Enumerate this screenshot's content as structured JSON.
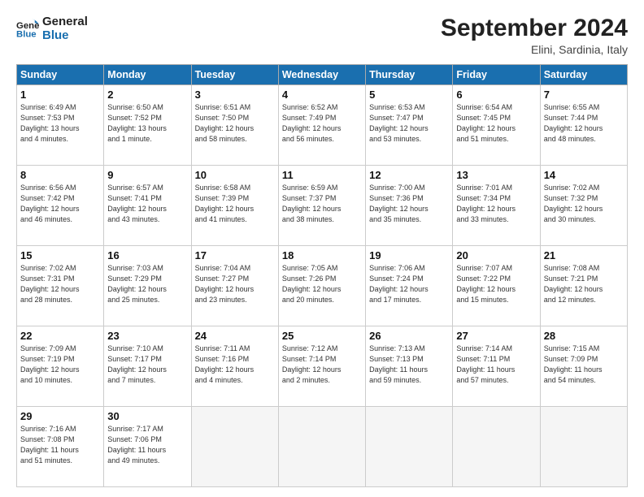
{
  "header": {
    "logo_line1": "General",
    "logo_line2": "Blue",
    "month_title": "September 2024",
    "location": "Elini, Sardinia, Italy"
  },
  "columns": [
    "Sunday",
    "Monday",
    "Tuesday",
    "Wednesday",
    "Thursday",
    "Friday",
    "Saturday"
  ],
  "weeks": [
    [
      {
        "day": "1",
        "info": "Sunrise: 6:49 AM\nSunset: 7:53 PM\nDaylight: 13 hours\nand 4 minutes."
      },
      {
        "day": "2",
        "info": "Sunrise: 6:50 AM\nSunset: 7:52 PM\nDaylight: 13 hours\nand 1 minute."
      },
      {
        "day": "3",
        "info": "Sunrise: 6:51 AM\nSunset: 7:50 PM\nDaylight: 12 hours\nand 58 minutes."
      },
      {
        "day": "4",
        "info": "Sunrise: 6:52 AM\nSunset: 7:49 PM\nDaylight: 12 hours\nand 56 minutes."
      },
      {
        "day": "5",
        "info": "Sunrise: 6:53 AM\nSunset: 7:47 PM\nDaylight: 12 hours\nand 53 minutes."
      },
      {
        "day": "6",
        "info": "Sunrise: 6:54 AM\nSunset: 7:45 PM\nDaylight: 12 hours\nand 51 minutes."
      },
      {
        "day": "7",
        "info": "Sunrise: 6:55 AM\nSunset: 7:44 PM\nDaylight: 12 hours\nand 48 minutes."
      }
    ],
    [
      {
        "day": "8",
        "info": "Sunrise: 6:56 AM\nSunset: 7:42 PM\nDaylight: 12 hours\nand 46 minutes."
      },
      {
        "day": "9",
        "info": "Sunrise: 6:57 AM\nSunset: 7:41 PM\nDaylight: 12 hours\nand 43 minutes."
      },
      {
        "day": "10",
        "info": "Sunrise: 6:58 AM\nSunset: 7:39 PM\nDaylight: 12 hours\nand 41 minutes."
      },
      {
        "day": "11",
        "info": "Sunrise: 6:59 AM\nSunset: 7:37 PM\nDaylight: 12 hours\nand 38 minutes."
      },
      {
        "day": "12",
        "info": "Sunrise: 7:00 AM\nSunset: 7:36 PM\nDaylight: 12 hours\nand 35 minutes."
      },
      {
        "day": "13",
        "info": "Sunrise: 7:01 AM\nSunset: 7:34 PM\nDaylight: 12 hours\nand 33 minutes."
      },
      {
        "day": "14",
        "info": "Sunrise: 7:02 AM\nSunset: 7:32 PM\nDaylight: 12 hours\nand 30 minutes."
      }
    ],
    [
      {
        "day": "15",
        "info": "Sunrise: 7:02 AM\nSunset: 7:31 PM\nDaylight: 12 hours\nand 28 minutes."
      },
      {
        "day": "16",
        "info": "Sunrise: 7:03 AM\nSunset: 7:29 PM\nDaylight: 12 hours\nand 25 minutes."
      },
      {
        "day": "17",
        "info": "Sunrise: 7:04 AM\nSunset: 7:27 PM\nDaylight: 12 hours\nand 23 minutes."
      },
      {
        "day": "18",
        "info": "Sunrise: 7:05 AM\nSunset: 7:26 PM\nDaylight: 12 hours\nand 20 minutes."
      },
      {
        "day": "19",
        "info": "Sunrise: 7:06 AM\nSunset: 7:24 PM\nDaylight: 12 hours\nand 17 minutes."
      },
      {
        "day": "20",
        "info": "Sunrise: 7:07 AM\nSunset: 7:22 PM\nDaylight: 12 hours\nand 15 minutes."
      },
      {
        "day": "21",
        "info": "Sunrise: 7:08 AM\nSunset: 7:21 PM\nDaylight: 12 hours\nand 12 minutes."
      }
    ],
    [
      {
        "day": "22",
        "info": "Sunrise: 7:09 AM\nSunset: 7:19 PM\nDaylight: 12 hours\nand 10 minutes."
      },
      {
        "day": "23",
        "info": "Sunrise: 7:10 AM\nSunset: 7:17 PM\nDaylight: 12 hours\nand 7 minutes."
      },
      {
        "day": "24",
        "info": "Sunrise: 7:11 AM\nSunset: 7:16 PM\nDaylight: 12 hours\nand 4 minutes."
      },
      {
        "day": "25",
        "info": "Sunrise: 7:12 AM\nSunset: 7:14 PM\nDaylight: 12 hours\nand 2 minutes."
      },
      {
        "day": "26",
        "info": "Sunrise: 7:13 AM\nSunset: 7:13 PM\nDaylight: 11 hours\nand 59 minutes."
      },
      {
        "day": "27",
        "info": "Sunrise: 7:14 AM\nSunset: 7:11 PM\nDaylight: 11 hours\nand 57 minutes."
      },
      {
        "day": "28",
        "info": "Sunrise: 7:15 AM\nSunset: 7:09 PM\nDaylight: 11 hours\nand 54 minutes."
      }
    ],
    [
      {
        "day": "29",
        "info": "Sunrise: 7:16 AM\nSunset: 7:08 PM\nDaylight: 11 hours\nand 51 minutes."
      },
      {
        "day": "30",
        "info": "Sunrise: 7:17 AM\nSunset: 7:06 PM\nDaylight: 11 hours\nand 49 minutes."
      },
      {
        "day": "",
        "info": ""
      },
      {
        "day": "",
        "info": ""
      },
      {
        "day": "",
        "info": ""
      },
      {
        "day": "",
        "info": ""
      },
      {
        "day": "",
        "info": ""
      }
    ]
  ]
}
